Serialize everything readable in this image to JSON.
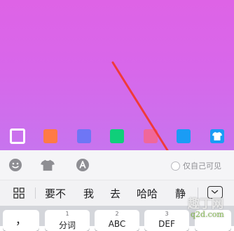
{
  "colors": {
    "swatch_orange": "#ff7a45",
    "swatch_blue": "#6e76f5",
    "swatch_green": "#0fcf7a",
    "swatch_pink": "#f0679a",
    "swatch_sky": "#1a9cf5",
    "swatch_shirt_bg": "#1a9cf5",
    "arrow": "#f03a3a"
  },
  "swatches": [
    {
      "name": "swatch-white-selected",
      "icon": "empty-square",
      "selected": true
    },
    {
      "name": "swatch-orange"
    },
    {
      "name": "swatch-blue"
    },
    {
      "name": "swatch-green"
    },
    {
      "name": "swatch-pink"
    },
    {
      "name": "swatch-sky-blue"
    },
    {
      "name": "swatch-shirt",
      "icon": "shirt-icon"
    }
  ],
  "toolbar": {
    "emoji_icon": "smiley-icon",
    "shirt_icon": "shirt-icon",
    "font_icon": "font-a-icon",
    "private_label": "仅自己可见"
  },
  "suggestions": {
    "menu_icon": "grid-icon",
    "items": [
      "要不",
      "我",
      "去",
      "哈哈",
      "静"
    ],
    "collapse_icon": "collapse-keyboard-icon"
  },
  "keys": [
    {
      "num": "",
      "label": "，"
    },
    {
      "num": "1",
      "label": "分词"
    },
    {
      "num": "2",
      "label": "ABC"
    },
    {
      "num": "3",
      "label": "DEF"
    }
  ],
  "watermark": {
    "main": "趣丁网",
    "sub": "q2d.com"
  }
}
